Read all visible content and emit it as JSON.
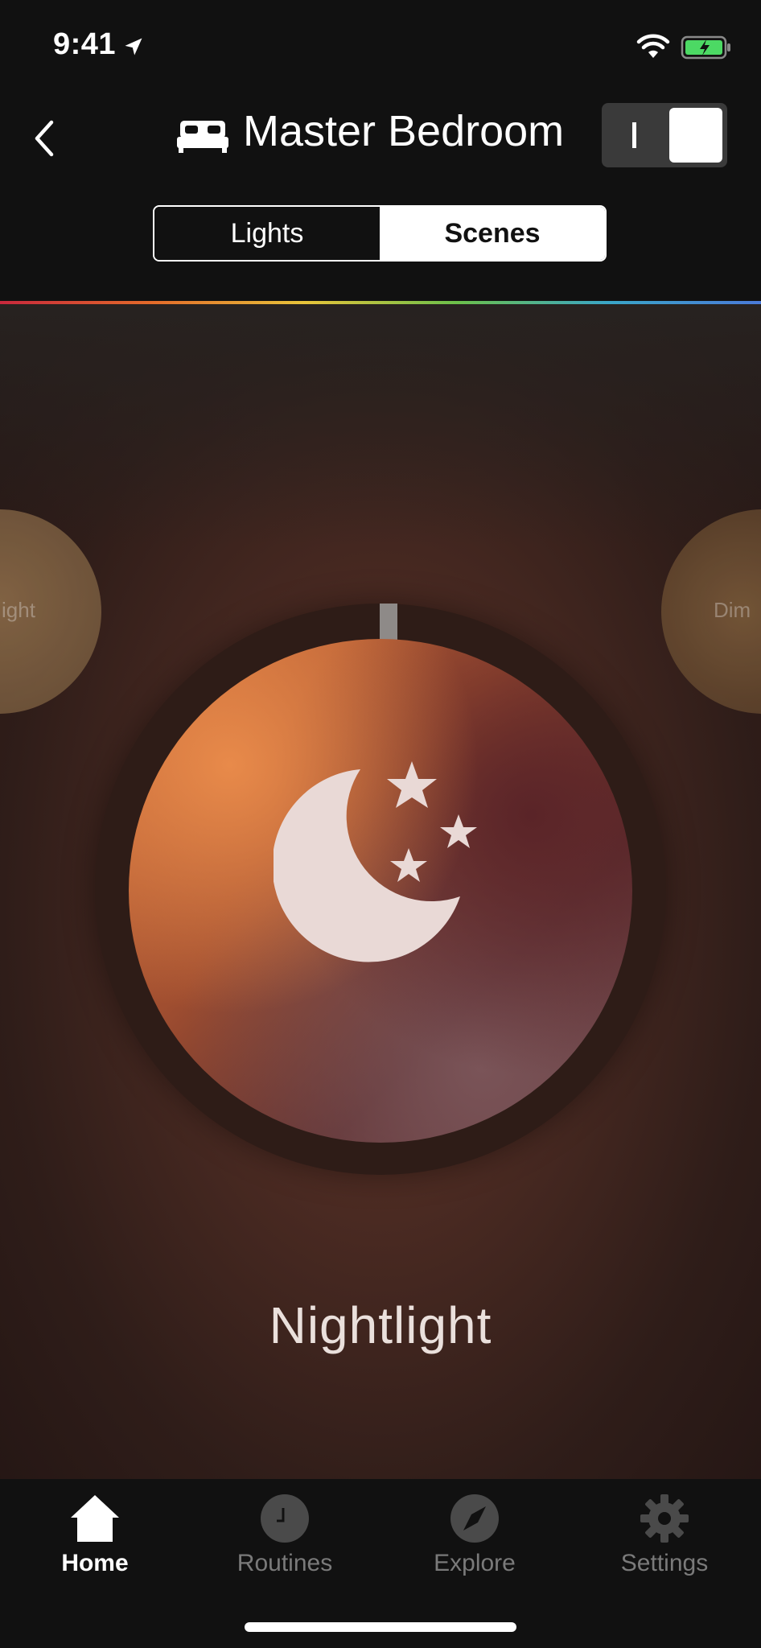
{
  "status_bar": {
    "time": "9:41"
  },
  "header": {
    "room_title": "Master Bedroom"
  },
  "segmented": {
    "lights_label": "Lights",
    "scenes_label": "Scenes",
    "selected": "Scenes"
  },
  "scene": {
    "current_name": "Nightlight",
    "left_partial_label": "ight",
    "right_partial_label": "Dim"
  },
  "tab_bar": {
    "items": [
      {
        "label": "Home",
        "icon": "home-icon",
        "active": true
      },
      {
        "label": "Routines",
        "icon": "clock-icon",
        "active": false
      },
      {
        "label": "Explore",
        "icon": "compass-icon",
        "active": false
      },
      {
        "label": "Settings",
        "icon": "gear-icon",
        "active": false
      }
    ]
  },
  "colors": {
    "accent_active": "#ffffff",
    "inactive": "#7a7a7a",
    "battery": "#4cd964"
  }
}
